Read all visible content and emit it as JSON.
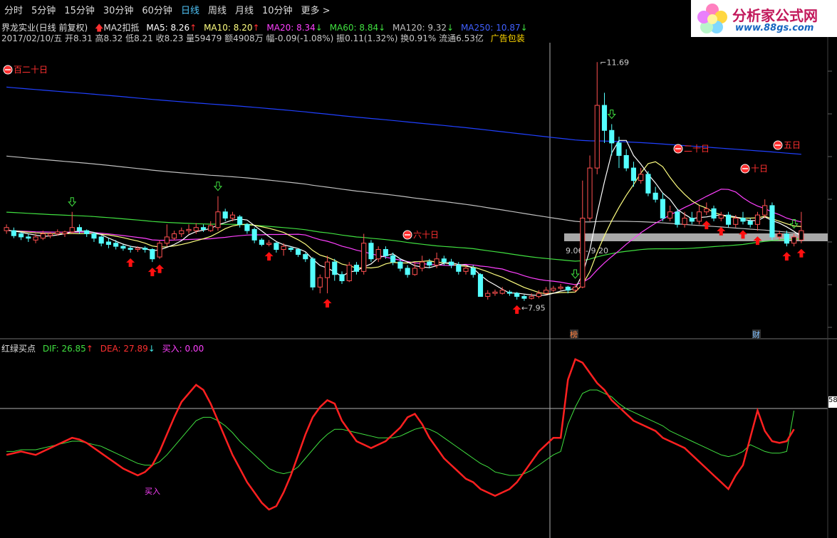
{
  "toolbar": {
    "tabs": [
      "分时",
      "5分钟",
      "15分钟",
      "30分钟",
      "60分钟",
      "日线",
      "周线",
      "月线",
      "10分钟",
      "更多 >"
    ],
    "active": 5
  },
  "logo": {
    "title": "分析家公式网",
    "url": "www.88gs.com"
  },
  "header": {
    "stock": "界龙实业(日线 前复权)",
    "ma2": "MA2扣抵",
    "ma5": "MA5: 8.26",
    "ma10": "MA10: 8.20",
    "ma20": "MA20: 8.34",
    "ma60": "MA60: 8.84",
    "ma120": "MA120: 9.32",
    "ma250": "MA250: 10.87",
    "quote": "2017/02/10/五 开8.31 高8.32 低8.21 收8.23 量59479 额4908万 幅-0.09(-1.08%) 振0.11(1.32%) 换0.91% 流通6.53亿",
    "ad": "广告包装"
  },
  "indicator": {
    "name": "红绿买点",
    "dif": "DIF: 26.85",
    "dea": "DEA: 27.89",
    "buy": "买入: 0.00"
  },
  "annotations": {
    "high": "11.69",
    "low": "7.95",
    "range": "9.06 - 9.20",
    "mark_bang": "榜",
    "mark_cai": "财",
    "badge_120": "百二十日",
    "badge_60": "六十日",
    "badge_20": "二十日",
    "badge_10": "十日",
    "badge_5": "五日",
    "right_value": "58",
    "crossover": "买入"
  },
  "colors": {
    "up": "#ff5050",
    "down": "#54ffff",
    "ma5": "#ffffff",
    "ma10": "#ffff80",
    "ma20": "#ff40ff",
    "ma60": "#40e040",
    "ma120": "#c0c0c0",
    "ma250": "#2040ff",
    "dif": "#40e040",
    "dea": "#ff2020"
  },
  "chart_data": {
    "type": "candlestick",
    "price_range": [
      7.4,
      12.0
    ],
    "candles": [
      [
        9.0,
        9.05,
        9.1,
        8.95
      ],
      [
        9.0,
        8.92,
        9.05,
        8.88
      ],
      [
        8.95,
        8.9,
        8.98,
        8.85
      ],
      [
        8.9,
        8.88,
        8.95,
        8.82
      ],
      [
        8.85,
        8.9,
        8.95,
        8.8
      ],
      [
        8.88,
        8.95,
        9.0,
        8.85
      ],
      [
        8.92,
        8.95,
        8.98,
        8.88
      ],
      [
        8.95,
        8.98,
        9.02,
        8.92
      ],
      [
        8.95,
        8.98,
        9.0,
        8.9
      ],
      [
        8.98,
        9.05,
        9.3,
        8.95
      ],
      [
        9.05,
        9.0,
        9.1,
        8.95
      ],
      [
        9.0,
        8.95,
        9.02,
        8.9
      ],
      [
        8.95,
        8.88,
        8.98,
        8.82
      ],
      [
        8.9,
        8.8,
        8.92,
        8.75
      ],
      [
        8.82,
        8.78,
        8.88,
        8.72
      ],
      [
        8.8,
        8.75,
        8.85,
        8.7
      ],
      [
        8.75,
        8.72,
        8.78,
        8.68
      ],
      [
        8.72,
        8.7,
        8.76,
        8.65
      ],
      [
        8.7,
        8.72,
        8.75,
        8.66
      ],
      [
        8.72,
        8.7,
        8.75,
        8.65
      ],
      [
        8.7,
        8.55,
        8.72,
        8.5
      ],
      [
        8.58,
        8.8,
        8.85,
        8.55
      ],
      [
        8.8,
        8.9,
        9.1,
        8.75
      ],
      [
        8.88,
        8.95,
        9.0,
        8.85
      ],
      [
        8.95,
        9.0,
        9.05,
        8.9
      ],
      [
        9.0,
        9.02,
        9.1,
        8.95
      ],
      [
        9.0,
        9.05,
        9.12,
        8.95
      ],
      [
        9.05,
        9.02,
        9.1,
        8.98
      ],
      [
        9.0,
        9.08,
        9.15,
        8.98
      ],
      [
        9.05,
        9.3,
        9.55,
        9.0
      ],
      [
        9.3,
        9.2,
        9.35,
        9.15
      ],
      [
        9.2,
        9.25,
        9.3,
        9.15
      ],
      [
        9.22,
        9.1,
        9.25,
        9.05
      ],
      [
        9.1,
        9.0,
        9.12,
        8.95
      ],
      [
        9.02,
        8.85,
        9.05,
        8.8
      ],
      [
        8.85,
        8.78,
        8.88,
        8.75
      ],
      [
        8.78,
        8.8,
        8.85,
        8.75
      ],
      [
        8.8,
        8.7,
        8.82,
        8.65
      ],
      [
        8.7,
        8.75,
        8.8,
        8.6
      ],
      [
        8.72,
        8.7,
        8.75,
        8.66
      ],
      [
        8.7,
        8.62,
        8.72,
        8.58
      ],
      [
        8.62,
        8.55,
        8.65,
        8.5
      ],
      [
        8.55,
        8.1,
        8.58,
        8.05
      ],
      [
        8.1,
        8.25,
        8.3,
        8.0
      ],
      [
        8.25,
        8.5,
        8.6,
        8.0
      ],
      [
        8.5,
        8.3,
        8.55,
        8.2
      ],
      [
        8.3,
        8.2,
        8.35,
        8.15
      ],
      [
        8.2,
        8.45,
        8.5,
        8.18
      ],
      [
        8.45,
        8.35,
        8.5,
        8.3
      ],
      [
        8.35,
        8.8,
        8.95,
        8.3
      ],
      [
        8.8,
        8.55,
        8.85,
        8.5
      ],
      [
        8.55,
        8.7,
        8.75,
        8.5
      ],
      [
        8.7,
        8.6,
        8.75,
        8.55
      ],
      [
        8.6,
        8.5,
        8.65,
        8.45
      ],
      [
        8.5,
        8.4,
        8.55,
        8.35
      ],
      [
        8.4,
        8.3,
        8.45,
        8.25
      ],
      [
        8.3,
        8.4,
        8.5,
        8.28
      ],
      [
        8.4,
        8.5,
        8.6,
        8.35
      ],
      [
        8.5,
        8.45,
        8.55,
        8.4
      ],
      [
        8.45,
        8.55,
        8.65,
        8.4
      ],
      [
        8.55,
        8.5,
        8.6,
        8.45
      ],
      [
        8.5,
        8.45,
        8.55,
        8.4
      ],
      [
        8.45,
        8.35,
        8.5,
        8.3
      ],
      [
        8.35,
        8.4,
        8.45,
        8.3
      ],
      [
        8.4,
        8.3,
        8.45,
        8.25
      ],
      [
        8.3,
        7.95,
        8.32,
        7.95
      ],
      [
        7.95,
        8.0,
        8.05,
        7.9
      ],
      [
        8.0,
        8.02,
        8.06,
        7.96
      ],
      [
        8.0,
        8.05,
        8.1,
        7.98
      ],
      [
        8.02,
        8.0,
        8.05,
        7.96
      ],
      [
        8.0,
        7.95,
        8.02,
        7.9
      ],
      [
        7.95,
        7.92,
        7.98,
        7.88
      ],
      [
        7.92,
        7.95,
        8.0,
        7.9
      ],
      [
        7.95,
        8.0,
        8.05,
        7.92
      ],
      [
        8.0,
        8.05,
        8.1,
        7.98
      ],
      [
        8.05,
        8.08,
        8.12,
        8.02
      ],
      [
        8.08,
        8.1,
        8.15,
        8.05
      ],
      [
        8.1,
        8.05,
        8.12,
        8.0
      ],
      [
        8.05,
        8.1,
        8.15,
        8.02
      ],
      [
        8.1,
        9.2,
        9.8,
        8.08
      ],
      [
        9.2,
        10.0,
        10.2,
        9.15
      ],
      [
        10.0,
        11.0,
        11.69,
        9.9
      ],
      [
        11.0,
        10.6,
        11.2,
        10.4
      ],
      [
        10.6,
        10.4,
        10.7,
        10.2
      ],
      [
        10.4,
        10.2,
        10.5,
        10.0
      ],
      [
        10.2,
        10.0,
        10.3,
        9.95
      ],
      [
        10.0,
        9.8,
        10.1,
        9.7
      ],
      [
        9.8,
        9.9,
        10.0,
        9.75
      ],
      [
        9.9,
        9.6,
        9.95,
        9.55
      ],
      [
        9.6,
        9.5,
        9.7,
        9.45
      ],
      [
        9.5,
        9.2,
        9.6,
        9.15
      ],
      [
        9.2,
        9.3,
        9.4,
        9.15
      ],
      [
        9.3,
        9.1,
        9.35,
        9.05
      ],
      [
        9.1,
        9.2,
        9.3,
        9.05
      ],
      [
        9.2,
        9.15,
        9.3,
        9.1
      ],
      [
        9.15,
        9.3,
        9.4,
        9.1
      ],
      [
        9.3,
        9.35,
        9.45,
        9.25
      ],
      [
        9.35,
        9.2,
        9.4,
        9.15
      ],
      [
        9.2,
        9.25,
        9.3,
        9.15
      ],
      [
        9.25,
        9.1,
        9.3,
        9.05
      ],
      [
        9.1,
        9.2,
        9.25,
        9.05
      ],
      [
        9.2,
        9.15,
        9.3,
        9.1
      ],
      [
        9.15,
        9.1,
        9.2,
        9.05
      ],
      [
        9.1,
        9.25,
        9.3,
        9.0
      ],
      [
        9.25,
        9.4,
        9.5,
        9.2
      ],
      [
        9.4,
        8.9,
        9.45,
        8.85
      ],
      [
        8.9,
        8.95,
        9.0,
        8.85
      ],
      [
        8.95,
        8.8,
        9.0,
        8.75
      ],
      [
        8.8,
        8.9,
        8.95,
        8.75
      ],
      [
        8.85,
        9.0,
        9.3,
        8.8
      ]
    ],
    "dif_range": [
      -40,
      60
    ],
    "dif": [
      2,
      3,
      4,
      3,
      2,
      4,
      6,
      8,
      10,
      12,
      11,
      9,
      6,
      3,
      0,
      -3,
      -6,
      -8,
      -10,
      -8,
      -4,
      4,
      14,
      24,
      33,
      38,
      43,
      40,
      32,
      22,
      12,
      2,
      -6,
      -14,
      -20,
      -26,
      -30,
      -28,
      -20,
      -10,
      2,
      14,
      24,
      30,
      34,
      32,
      22,
      16,
      10,
      8,
      6,
      8,
      10,
      14,
      18,
      24,
      26,
      20,
      12,
      6,
      0,
      -4,
      -8,
      -12,
      -14,
      -18,
      -20,
      -22,
      -20,
      -18,
      -14,
      -8,
      -2,
      4,
      8,
      12,
      12,
      46,
      58,
      56,
      50,
      44,
      40,
      34,
      30,
      26,
      22,
      20,
      18,
      16,
      12,
      10,
      8,
      6,
      2,
      -2,
      -6,
      -10,
      -14,
      -18,
      -10,
      -4,
      12,
      28,
      16,
      10,
      9,
      10,
      17
    ],
    "dea": [
      4,
      4,
      5,
      5,
      5,
      6,
      7,
      8,
      9,
      10,
      10,
      9,
      8,
      7,
      5,
      3,
      1,
      -1,
      -3,
      -4,
      -4,
      -2,
      2,
      7,
      12,
      17,
      22,
      24,
      24,
      22,
      19,
      15,
      10,
      6,
      2,
      -2,
      -6,
      -8,
      -9,
      -8,
      -5,
      0,
      5,
      10,
      14,
      17,
      17,
      16,
      15,
      14,
      13,
      12,
      12,
      12,
      13,
      15,
      17,
      18,
      17,
      15,
      12,
      9,
      6,
      3,
      0,
      -3,
      -5,
      -8,
      -9,
      -10,
      -10,
      -9,
      -7,
      -4,
      -1,
      2,
      4,
      20,
      30,
      38,
      40,
      40,
      38,
      36,
      32,
      29,
      27,
      25,
      23,
      21,
      19,
      16,
      14,
      12,
      10,
      8,
      6,
      4,
      2,
      1,
      2,
      4,
      8,
      6,
      4,
      3,
      3,
      4,
      27.89
    ]
  }
}
